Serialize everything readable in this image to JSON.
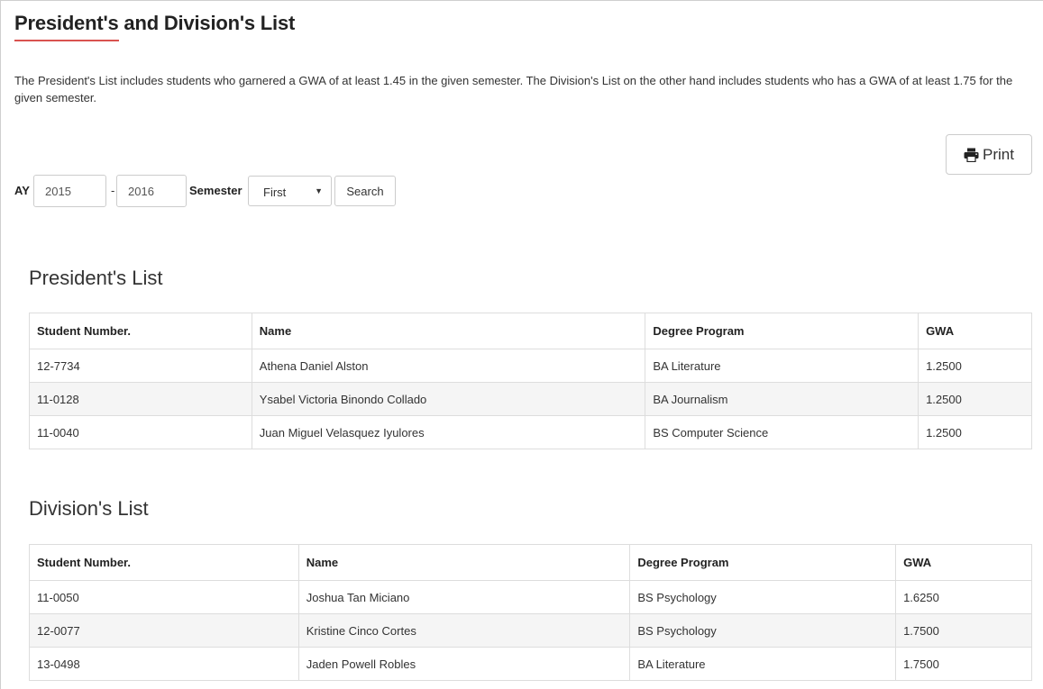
{
  "page": {
    "title": "President's and Division's List",
    "intro": "The President's List includes students who garnered a GWA of at least 1.45 in the given semester. The Division's List on the other hand includes students who has a GWA of at least 1.75 for the given semester.",
    "accent_color": "#d9534f"
  },
  "toolbar": {
    "print_label": "Print",
    "print_icon": "printer-icon"
  },
  "search": {
    "ay_label": "AY",
    "ay_start": "2015",
    "ay_separator": "-",
    "ay_end": "2016",
    "semester_label": "Semester",
    "semester_value": "First",
    "search_label": "Search"
  },
  "presidents_list": {
    "title": "President's List",
    "columns": [
      "Student Number.",
      "Name",
      "Degree Program",
      "GWA"
    ],
    "rows": [
      [
        "12-7734",
        "Athena Daniel Alston",
        "BA Literature",
        "1.2500"
      ],
      [
        "11-0128",
        "Ysabel Victoria Binondo Collado",
        "BA Journalism",
        "1.2500"
      ],
      [
        "11-0040",
        "Juan Miguel Velasquez Iyulores",
        "BS Computer Science",
        "1.2500"
      ]
    ]
  },
  "divisions_list": {
    "title": "Division's List",
    "columns": [
      "Student Number.",
      "Name",
      "Degree Program",
      "GWA"
    ],
    "rows": [
      [
        "11-0050",
        "Joshua Tan Miciano",
        "BS Psychology",
        "1.6250"
      ],
      [
        "12-0077",
        "Kristine Cinco Cortes",
        "BS Psychology",
        "1.7500"
      ],
      [
        "13-0498",
        "Jaden Powell Robles",
        "BA Literature",
        "1.7500"
      ]
    ]
  }
}
